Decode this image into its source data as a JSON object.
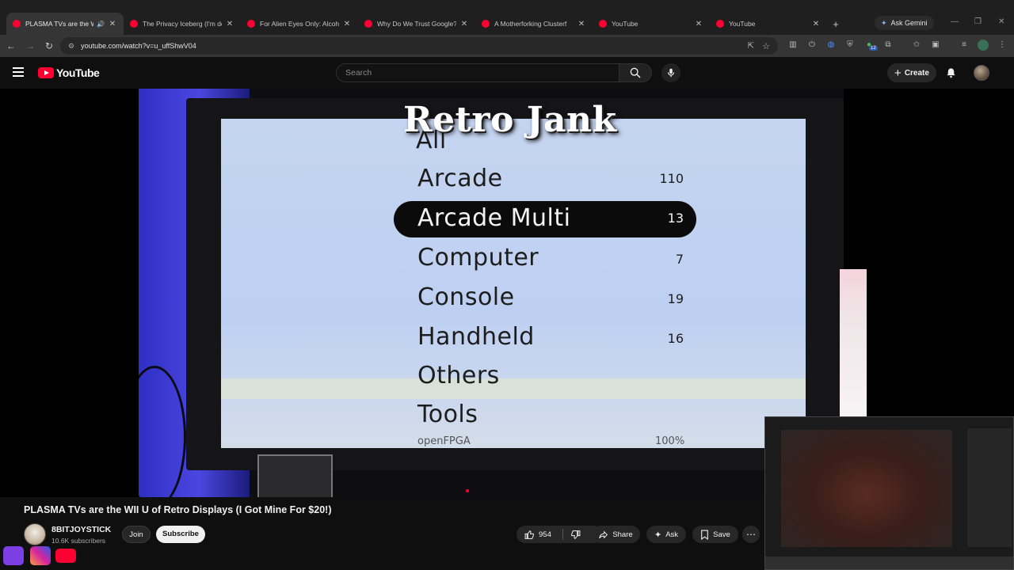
{
  "browser": {
    "tabs": [
      {
        "title": "PLASMA TVs are the WI",
        "active": true,
        "audio": true
      },
      {
        "title": "The Privacy Iceberg (I'm des",
        "active": false
      },
      {
        "title": "For Alien Eyes Only: Alcohol",
        "active": false
      },
      {
        "title": "Why Do We Trust Google? -",
        "active": false
      },
      {
        "title": "A Motherforking Clusterf",
        "active": false
      },
      {
        "title": "YouTube",
        "active": false
      },
      {
        "title": "YouTube",
        "active": false
      }
    ],
    "ask_gemini": "Ask Gemini",
    "url": "youtube.com/watch?v=u_uffShwV04",
    "extension_badge": "12"
  },
  "youtube": {
    "logo_text": "YouTube",
    "search_placeholder": "Search",
    "create_label": "Create"
  },
  "video_frame": {
    "overlay_title": "Retro Jank",
    "menu": [
      {
        "label": "All",
        "count": ""
      },
      {
        "label": "Arcade",
        "count": "110"
      },
      {
        "label": "Arcade Multi",
        "count": "13",
        "selected": true
      },
      {
        "label": "Computer",
        "count": "7"
      },
      {
        "label": "Console",
        "count": "19"
      },
      {
        "label": "Handheld",
        "count": "16"
      },
      {
        "label": "Others",
        "count": ""
      },
      {
        "label": "Tools",
        "count": ""
      }
    ],
    "footer_left": "openFPGA",
    "footer_right": "100%"
  },
  "watch": {
    "title": "PLASMA TVs are the WII U of Retro Displays (I Got Mine For $20!)",
    "channel_name": "8BITJOYSTICK",
    "subscribers": "10.6K subscribers",
    "join_label": "Join",
    "subscribe_label": "Subscribe",
    "like_count": "954",
    "share_label": "Share",
    "ask_label": "Ask",
    "save_label": "Save"
  },
  "colors": {
    "brand_red": "#ff0033",
    "background": "#0f0f0f",
    "pill_bg": "#272727"
  }
}
